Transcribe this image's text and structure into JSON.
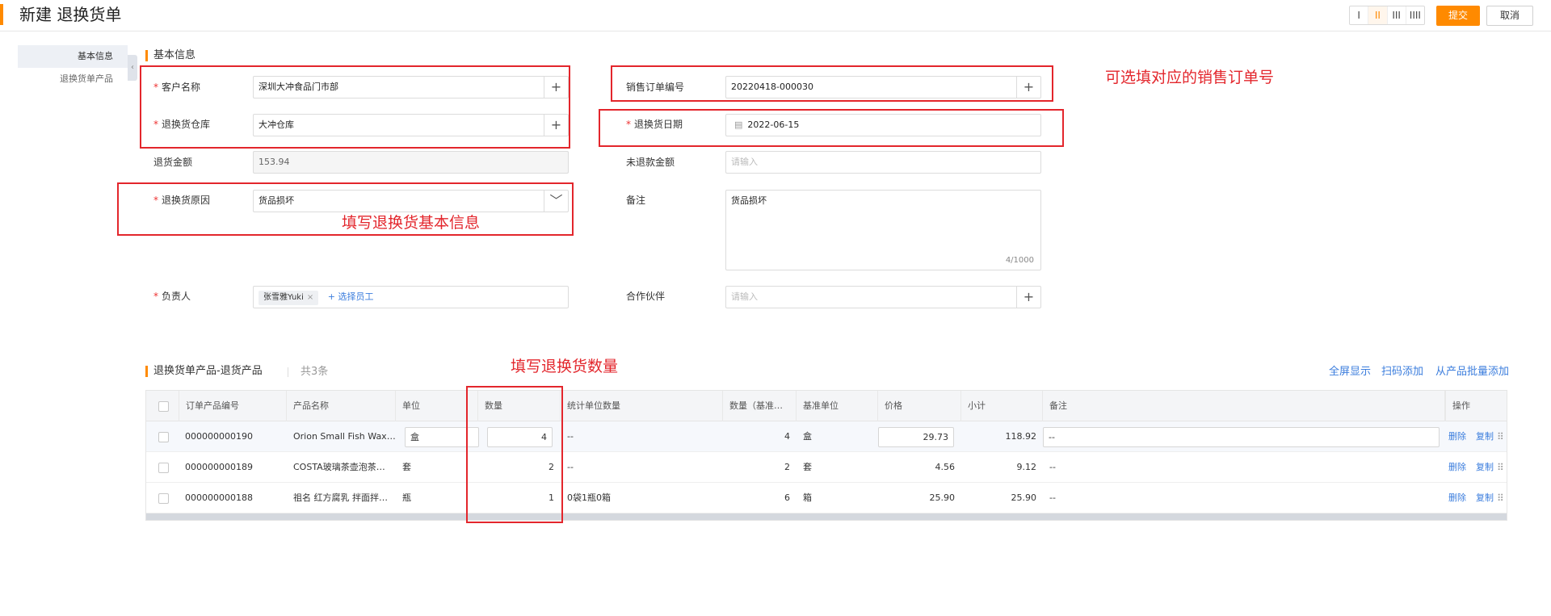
{
  "header": {
    "title": "新建 退换货单",
    "layout_options": [
      "I",
      "II",
      "III",
      "IIII"
    ],
    "active_layout": 1,
    "submit_label": "提交",
    "cancel_label": "取消"
  },
  "leftnav": {
    "items": [
      {
        "label": "基本信息",
        "active": true
      },
      {
        "label": "退换货单产品",
        "active": false
      }
    ],
    "collapse_glyph": "‹"
  },
  "basic": {
    "section_title": "基本信息",
    "customer": {
      "label": "客户名称",
      "required": true,
      "value": "深圳大冲食品门市部"
    },
    "warehouse": {
      "label": "退换货仓库",
      "required": true,
      "value": "大冲仓库"
    },
    "amount": {
      "label": "退货金额",
      "required": false,
      "value": "153.94"
    },
    "reason": {
      "label": "退换货原因",
      "required": true,
      "value": "货品损坏"
    },
    "owner": {
      "label": "负责人",
      "required": true,
      "tag": "张雪雅Yuki",
      "tag_close": "×",
      "pick_label": "+ 选择员工"
    },
    "sales_order": {
      "label": "销售订单编号",
      "required": false,
      "value": "20220418-000030"
    },
    "return_date": {
      "label": "退换货日期",
      "required": true,
      "value": "2022-06-15"
    },
    "unrefunded": {
      "label": "未退款金额",
      "required": false,
      "placeholder": "请输入"
    },
    "remark": {
      "label": "备注",
      "value": "货品损坏",
      "counter": "4/1000"
    },
    "partner": {
      "label": "合作伙伴",
      "placeholder": "请输入"
    },
    "plus_glyph": "+",
    "chevron_glyph": "﹀",
    "calendar_glyph": "▤"
  },
  "annotations": {
    "sales_order_hint": "可选填对应的销售订单号",
    "basic_hint": "填写退换货基本信息",
    "qty_hint": "填写退换货数量"
  },
  "products": {
    "section_title": "退换货单产品-退货产品",
    "count": "共3条",
    "actions": [
      "全屏显示",
      "扫码添加",
      "从产品批量添加"
    ],
    "columns": [
      "订单产品编号",
      "产品名称",
      "单位",
      "数量",
      "统计单位数量",
      "数量（基准…",
      "基准单位",
      "价格",
      "小计",
      "备注",
      "操作"
    ],
    "rows": [
      {
        "code": "000000000190",
        "name": "Orion Small Fish Wax…",
        "unit": "盒",
        "qty": "4",
        "stat_qty": "--",
        "base_qty": "4",
        "base_unit": "盒",
        "price": "29.73",
        "subtotal": "118.92",
        "remark": "--"
      },
      {
        "code": "000000000189",
        "name": "COSTA玻璃茶壶泡茶…",
        "unit": "套",
        "qty": "2",
        "stat_qty": "--",
        "base_qty": "2",
        "base_unit": "套",
        "price": "4.56",
        "subtotal": "9.12",
        "remark": "--"
      },
      {
        "code": "000000000188",
        "name": "祖名 红方腐乳 拌面拌…",
        "unit": "瓶",
        "qty": "1",
        "stat_qty": "0袋1瓶0箱",
        "base_qty": "6",
        "base_unit": "箱",
        "price": "25.90",
        "subtotal": "25.90",
        "remark": "--"
      }
    ],
    "row_ops": {
      "delete": "删除",
      "copy": "复制",
      "drag_glyph": "⠿"
    }
  }
}
